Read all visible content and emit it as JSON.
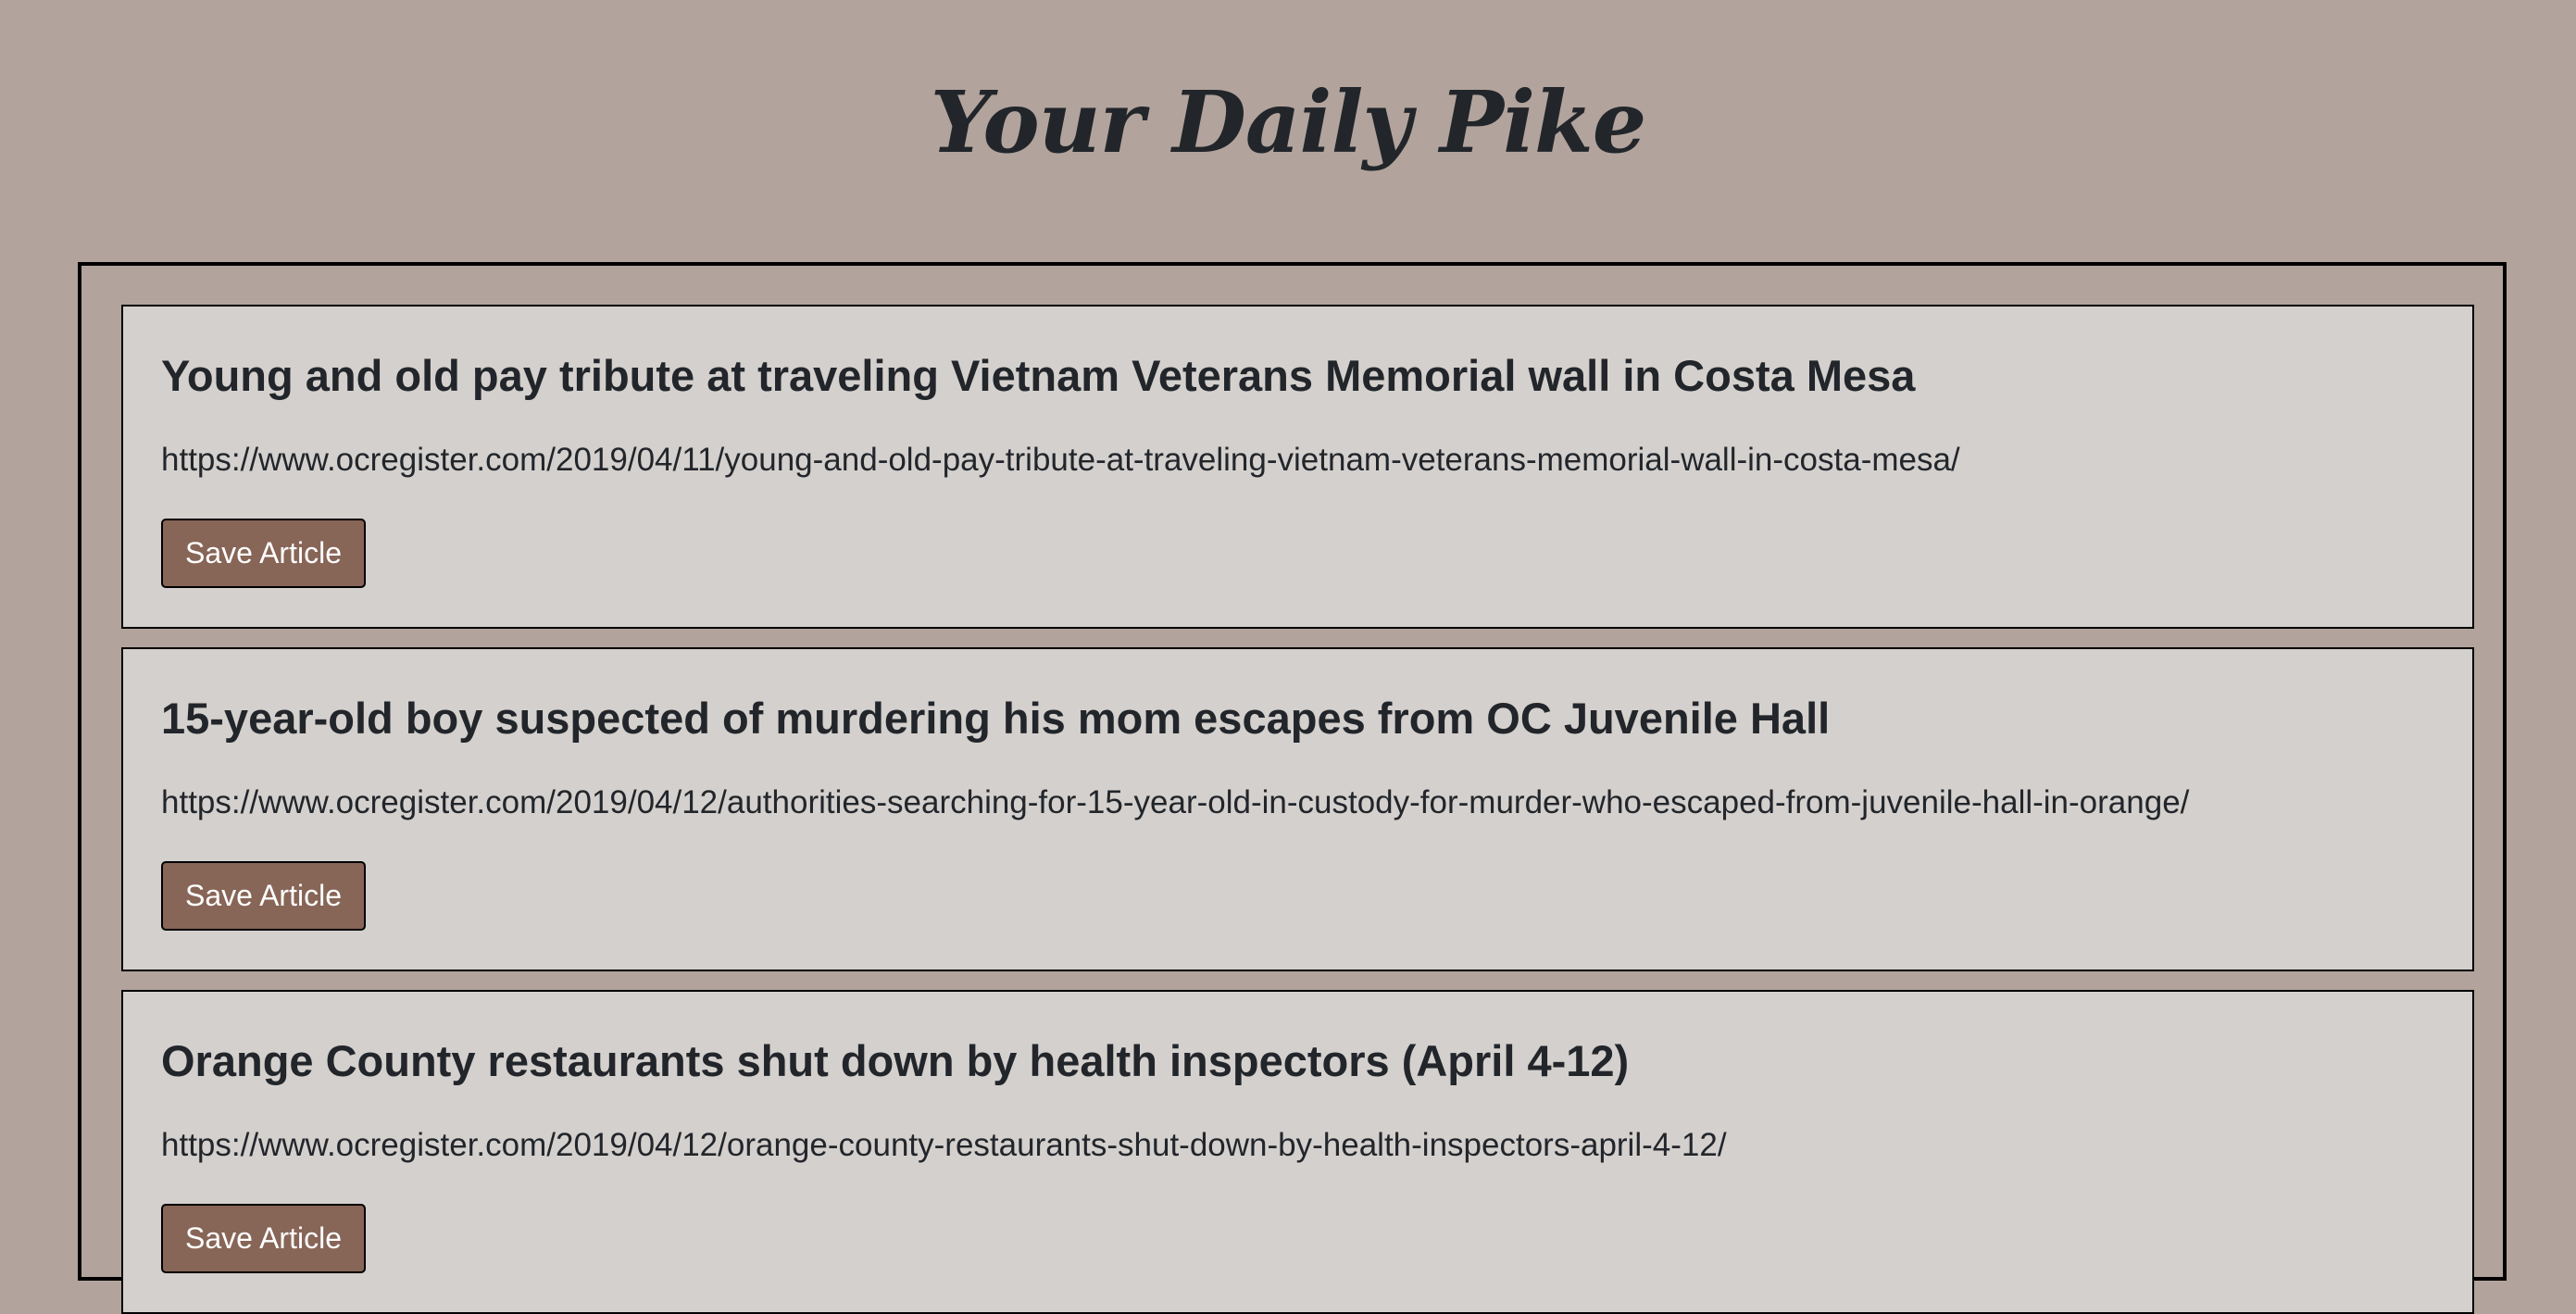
{
  "header": {
    "title": "Your Daily Pike"
  },
  "articles": [
    {
      "title": "Young and old pay tribute at traveling Vietnam Veterans Memorial wall in Costa Mesa",
      "url": "https://www.ocregister.com/2019/04/11/young-and-old-pay-tribute-at-traveling-vietnam-veterans-memorial-wall-in-costa-mesa/",
      "button_label": "Save Article"
    },
    {
      "title": "15-year-old boy suspected of murdering his mom escapes from OC Juvenile Hall",
      "url": "https://www.ocregister.com/2019/04/12/authorities-searching-for-15-year-old-in-custody-for-murder-who-escaped-from-juvenile-hall-in-orange/",
      "button_label": "Save Article"
    },
    {
      "title": "Orange County restaurants shut down by health inspectors (April 4-12)",
      "url": "https://www.ocregister.com/2019/04/12/orange-county-restaurants-shut-down-by-health-inspectors-april-4-12/",
      "button_label": "Save Article"
    }
  ],
  "colors": {
    "page_background": "#b2a49c",
    "card_background": "#d4d0cd",
    "button_background": "#876557",
    "text": "#22262b"
  }
}
